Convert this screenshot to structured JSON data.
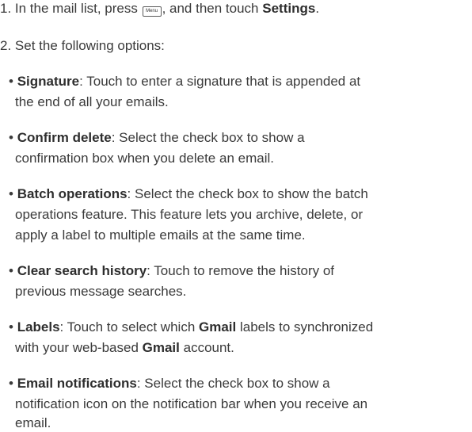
{
  "step1": {
    "prefix": "1. In the mail list, press",
    "menu_key": "Menu",
    "middle": ", and then touch",
    "settings": "Settings",
    "end": "."
  },
  "step2": "2. Set the following options:",
  "bullet": "•",
  "options": [
    {
      "term": "Signature",
      "lines": [
        ": Touch to enter a signature that is appended at",
        "the end of all your emails."
      ]
    },
    {
      "term": "Confirm delete",
      "lines": [
        ": Select the check box to show a",
        "confirmation box when you delete an email."
      ]
    },
    {
      "term": "Batch operations",
      "lines": [
        ": Select the check box to show the batch",
        "operations feature. This feature lets you archive, delete, or",
        "apply a label to multiple emails at the same time."
      ]
    },
    {
      "term": "Clear search history",
      "lines": [
        ": Touch to remove the history of",
        "previous message searches."
      ]
    },
    {
      "term": "Labels",
      "parts": [
        ": Touch to select which ",
        "Gmail",
        " labels to synchronized",
        "with your web-based ",
        "Gmail",
        " account."
      ]
    },
    {
      "term": "Email notifications",
      "lines": [
        ": Select the check box to show a",
        "notification icon on the notification bar when you receive an",
        "email."
      ]
    }
  ]
}
